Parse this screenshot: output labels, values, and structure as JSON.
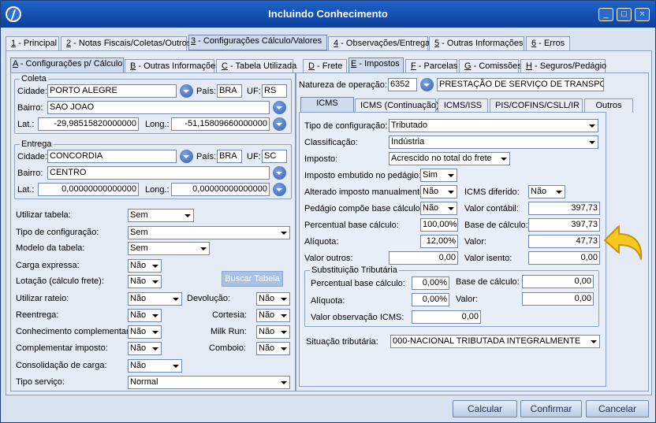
{
  "window": {
    "title": "Incluindo Conhecimento",
    "min": "_",
    "max": "□",
    "close": "×"
  },
  "main_tabs": [
    {
      "num": "1",
      "label": " - Principal"
    },
    {
      "num": "2",
      "label": " - Notas Fiscais/Coletas/Outros"
    },
    {
      "num": "3",
      "label": " - Configurações Cálculo/Valores"
    },
    {
      "num": "4",
      "label": " - Observações/Entrega"
    },
    {
      "num": "5",
      "label": " - Outras Informações"
    },
    {
      "num": "6",
      "label": " - Erros"
    }
  ],
  "left_tabs": [
    {
      "num": "A",
      "label": " - Configurações p/ Cálculo"
    },
    {
      "num": "B",
      "label": " - Outras Informações"
    },
    {
      "num": "C",
      "label": " - Tabela Utilizada"
    }
  ],
  "coleta": {
    "title": "Coleta",
    "cidade_label": "Cidade:",
    "cidade": "PORTO ALEGRE",
    "pais_label": "País:",
    "pais": "BRA",
    "uf_label": "UF:",
    "uf": "RS",
    "bairro_label": "Bairro:",
    "bairro": "SAO JOAO",
    "lat_label": "Lat.:",
    "lat": "-29,98515820000000",
    "long_label": "Long.:",
    "long": "-51,15809660000000"
  },
  "entrega": {
    "title": "Entrega",
    "cidade_label": "Cidade:",
    "cidade": "CONCORDIA",
    "pais_label": "País:",
    "pais": "BRA",
    "uf_label": "UF:",
    "uf": "SC",
    "bairro_label": "Bairro:",
    "bairro": "CENTRO",
    "lat_label": "Lat.:",
    "lat": "0,00000000000000",
    "long_label": "Long.:",
    "long": "0,00000000000000"
  },
  "left_form": {
    "utilizar_tabela_label": "Utilizar tabela:",
    "utilizar_tabela": "Sem",
    "tipo_config_label": "Tipo de configuração:",
    "tipo_config": "Sem",
    "modelo_label": "Modelo da tabela:",
    "modelo": "Sem",
    "carga_label": "Carga expressa:",
    "carga": "Não",
    "lotacao_label": "Lotação (cálculo frete):",
    "lotacao": "Não",
    "buscar_tabela": "Buscar Tabela",
    "rateio_label": "Utilizar rateio:",
    "rateio": "Não",
    "devolucao_label": "Devolução:",
    "devolucao": "Não",
    "reentrega_label": "Reentrega:",
    "reentrega": "Não",
    "cortesia_label": "Cortesia:",
    "cortesia": "Não",
    "complementar_label": "Conhecimento complementar:",
    "complementar": "Não",
    "milkrun_label": "Milk Run:",
    "milkrun": "Não",
    "comp_imposto_label": "Complementar imposto:",
    "comp_imposto": "Não",
    "comboio_label": "Comboio:",
    "comboio": "Não",
    "consolidacao_label": "Consolidação de carga:",
    "consolidacao": "Não",
    "tipo_servico_label": "Tipo serviço:",
    "tipo_servico": "Normal"
  },
  "right_tabs": [
    {
      "num": "D",
      "label": " - Frete"
    },
    {
      "num": "E",
      "label": " - Impostos"
    },
    {
      "num": "F",
      "label": " - Parcelas"
    },
    {
      "num": "G",
      "label": " - Comissões"
    },
    {
      "num": "H",
      "label": " - Seguros/Pedágio"
    }
  ],
  "natureza": {
    "label": "Natureza de operação:",
    "code": "6352",
    "desc": "PRESTAÇÃO DE SERVIÇO DE TRANSPOI"
  },
  "icms_tabs": [
    "ICMS",
    "ICMS (Continuação)",
    "ICMS/ISS",
    "PIS/COFINS/CSLL/IR",
    "Outros"
  ],
  "icms": {
    "tipo_config_label": "Tipo de configuração:",
    "tipo_config": "Tributado",
    "classificacao_label": "Classificação:",
    "classificacao": "Indústria",
    "imposto_label": "Imposto:",
    "imposto": "Acrescido no total do frete",
    "embutido_label": "Imposto embutido no pedágio:",
    "embutido": "Sim",
    "alterado_label": "Alterado imposto manualmente:",
    "alterado": "Não",
    "diferido_label": "ICMS diferido:",
    "diferido": "Não",
    "pedagio_label": "Pedágio compõe base cálculo:",
    "pedagio": "Não",
    "valor_contabil_label": "Valor contábil:",
    "valor_contabil": "397,73",
    "perc_base_label": "Percentual base cálculo:",
    "perc_base": "100,00%",
    "base_calc_label": "Base de cálculo:",
    "base_calc": "397,73",
    "aliquota_label": "Alíquota:",
    "aliquota": "12,00%",
    "valor_label": "Valor:",
    "valor": "47,73",
    "outros_label": "Valor outros:",
    "outros": "0,00",
    "isento_label": "Valor isento:",
    "isento": "0,00"
  },
  "st": {
    "title": "Substituição Tributária",
    "perc_label": "Percentual base cálculo:",
    "perc": "0,00%",
    "base_label": "Base de cálculo:",
    "base": "0,00",
    "aliq_label": "Alíquota:",
    "aliq": "0,00%",
    "valor_label": "Valor:",
    "valor": "0,00",
    "obs_label": "Valor observação ICMS:",
    "obs": "0,00"
  },
  "situacao": {
    "label": "Situação tributária:",
    "value": "000-NACIONAL TRIBUTADA INTEGRALMENTE"
  },
  "buttons": {
    "calcular": "Calcular",
    "confirmar": "Confirmar",
    "cancelar": "Cancelar"
  },
  "colors": {
    "titlebar": "#1f63c9",
    "panel": "#e4ebf5",
    "arrow": "#f4c81f"
  },
  "icons": [
    "app-logo-icon",
    "combo-circle-icon",
    "dropdown-arrow-icon",
    "return-arrow-icon"
  ]
}
